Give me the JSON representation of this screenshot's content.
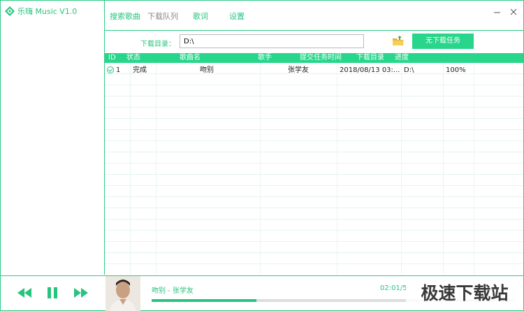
{
  "app": {
    "title": "乐嗨 Music V1.0",
    "accent_color": "#27c47f"
  },
  "nav": {
    "tabs": [
      {
        "label": "搜索歌曲",
        "active": false
      },
      {
        "label": "下载队列",
        "active": true
      },
      {
        "label": "歌词",
        "active": false
      },
      {
        "label": "设置",
        "active": false
      }
    ],
    "minimize_icon": "minimize-icon",
    "close_icon": "close-icon"
  },
  "download": {
    "dir_label": "下载目录：",
    "dir_value": "D:\\",
    "folder_icon": "folder-icon",
    "no_task_button": "无下载任务"
  },
  "table": {
    "columns": [
      "ID",
      "状态",
      "歌曲名",
      "歌手",
      "提交任务时间",
      "下载目录",
      "进度"
    ],
    "rows": [
      {
        "id": "1",
        "status": "完成",
        "song": "吻别",
        "artist": "张学友",
        "submit_time": "2018/08/13 03:...",
        "dir": "D:\\",
        "progress": "100%"
      }
    ]
  },
  "player": {
    "prev_icon": "rewind-icon",
    "pause_icon": "pause-icon",
    "next_icon": "fast-forward-icon",
    "song_info": "吻别 - 张学友",
    "time": "02:01/5",
    "progress_fraction": 0.29,
    "watermark": "极速下载站"
  }
}
